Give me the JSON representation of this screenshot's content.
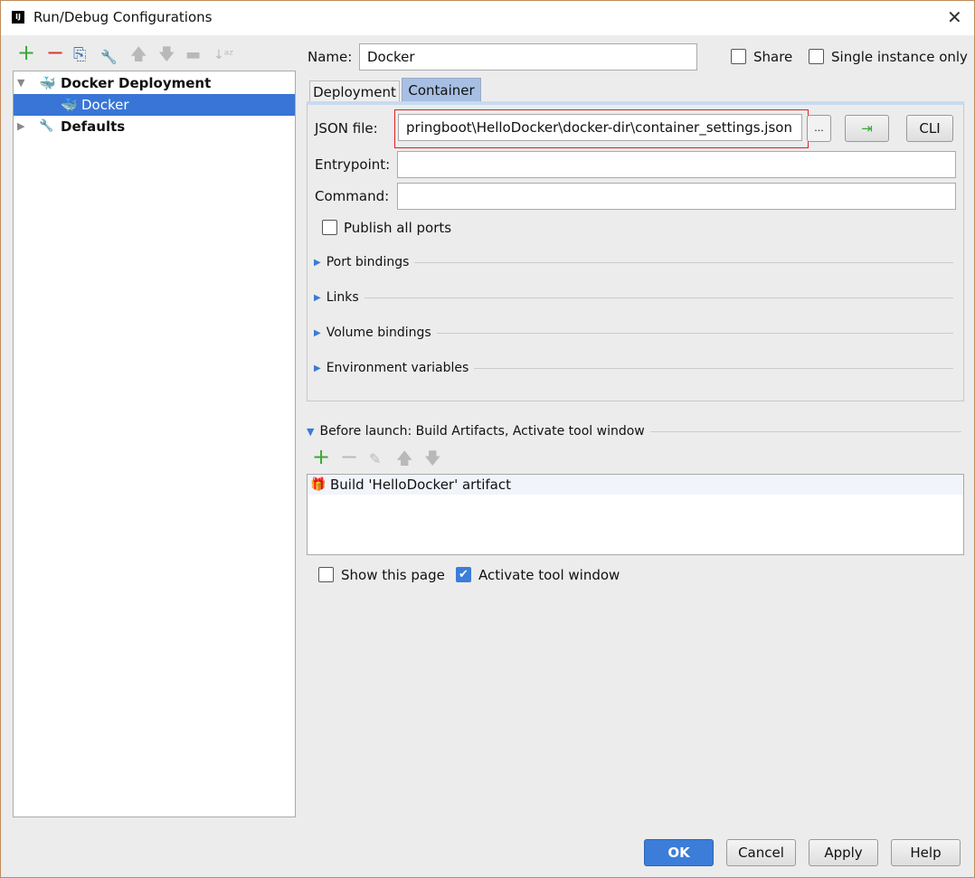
{
  "window": {
    "title": "Run/Debug Configurations",
    "close": "✕",
    "logo": "IJ"
  },
  "toolbar": {
    "add": "+",
    "remove": "−",
    "copy": "⎘",
    "edit": "🔧",
    "up": "🡅",
    "down": "🡇",
    "folder": "▬",
    "sort": "↓ᵃᶻ"
  },
  "tree": [
    {
      "label": "Docker Deployment",
      "expanded": true
    },
    {
      "label": "Docker",
      "selected": true
    },
    {
      "label": "Defaults",
      "expanded": false
    }
  ],
  "name": {
    "label": "Name:",
    "value": "Docker"
  },
  "share": {
    "label": "Share",
    "checked": false
  },
  "single": {
    "label": "Single instance only",
    "checked": false
  },
  "tabs": [
    {
      "label": "Deployment"
    },
    {
      "label": "Container",
      "active": true
    }
  ],
  "container": {
    "json_label": "JSON file:",
    "json_value": "pringboot\\HelloDocker\\docker-dir\\container_settings.json",
    "browse": "...",
    "cli": "CLI",
    "entry_label": "Entrypoint:",
    "entry_value": "",
    "cmd_label": "Command:",
    "cmd_value": "",
    "publish": {
      "label": "Publish all ports",
      "checked": false
    },
    "sections": [
      "Port bindings",
      "Links",
      "Volume bindings",
      "Environment variables"
    ]
  },
  "before": {
    "title": "Before launch: Build Artifacts, Activate tool window",
    "items": [
      "Build 'HelloDocker' artifact"
    ]
  },
  "show_page": {
    "label": "Show this page",
    "checked": false
  },
  "activate": {
    "label": "Activate tool window",
    "checked": true
  },
  "buttons": {
    "ok": "OK",
    "cancel": "Cancel",
    "apply": "Apply",
    "help": "Help"
  },
  "colors": {
    "accent": "#3875d7",
    "highlight": "#e02020"
  }
}
